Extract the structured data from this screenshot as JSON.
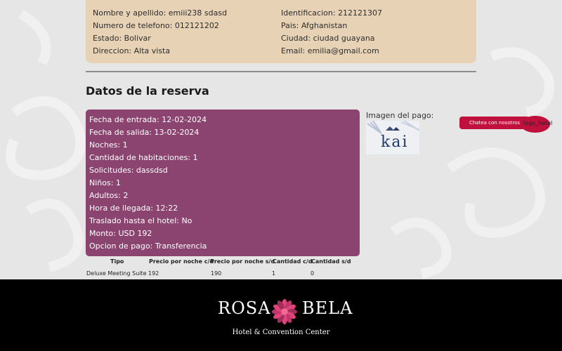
{
  "client": {
    "nombre": "Nombre y apellido: emiii238 sdasd",
    "identificacion": "Identificacion: 212121307",
    "telefono": "Numero de telefono: 012121202",
    "pais": "Pais: Afghanistan",
    "estado": "Estado: Bolivar",
    "ciudad": "Ciudad: ciudad guayana",
    "direccion": "Direccion: Alta vista",
    "email": "Email: emilia@gmail.com"
  },
  "reserva": {
    "title": "Datos de la reserva",
    "fecha_entrada": "Fecha de entrada: 12-02-2024",
    "fecha_salida": "Fecha de salida: 13-02-2024",
    "noches": "Noches: 1",
    "habitaciones": "Cantidad de habitaciones: 1",
    "solicitudes": "Solicitudes: dassdsd",
    "ninos": "Niños: 1",
    "adultos": "Adultos: 2",
    "hora_llegada": "Hora de llegada: 12:22",
    "traslado": "Traslado hasta el hotel: No",
    "monto": "Monto: USD 192",
    "opcion_pago": "Opcion de pago: Transferencia"
  },
  "pago": {
    "label": "Imagen del pago:",
    "thumb_text": "kai"
  },
  "chat": {
    "label": "Chatea con nosotros",
    "logo_alt": "logo_hotel"
  },
  "pricing": {
    "headers": [
      "Tipo",
      "Precio por noche c/d",
      "Precio por noche s/d",
      "Cantidad c/d",
      "Cantidad s/d"
    ],
    "row": [
      "Deluxe Meeting Suite",
      "192",
      "190",
      "1",
      "0"
    ]
  },
  "footer": {
    "brand_left": "ROSA",
    "brand_right": "BELA",
    "tagline": "Hotel & Convention Center"
  },
  "colors": {
    "client_card": "#e8d2b5",
    "reserva_card": "#8b4470",
    "chat_button": "#c0113e",
    "footer": "#000000"
  }
}
